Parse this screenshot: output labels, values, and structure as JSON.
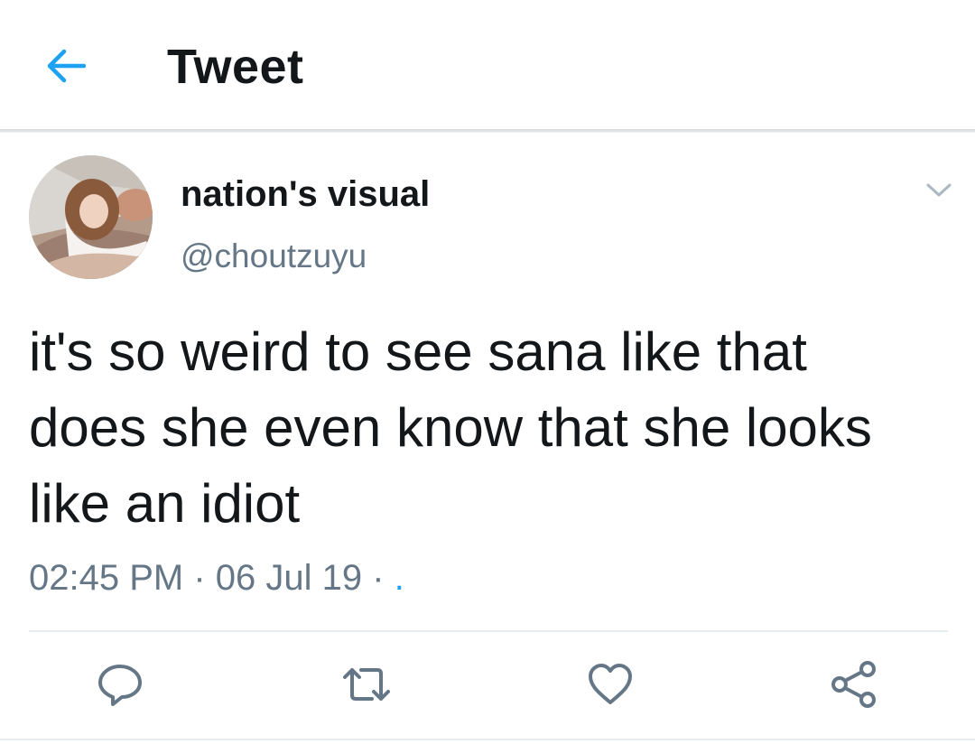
{
  "header": {
    "title": "Tweet",
    "back_icon": "arrow-left-icon",
    "accent_color": "#1da1f2"
  },
  "tweet": {
    "display_name": "nation's visual",
    "handle": "@choutzuyu",
    "text": "it's so weird to see sana like that\ndoes she even know that she looks\nlike an idiot",
    "time": "02:45 PM",
    "date": "06 Jul 19",
    "separator": "·",
    "source": "."
  },
  "actions": [
    {
      "name": "reply",
      "icon": "reply-icon"
    },
    {
      "name": "retweet",
      "icon": "retweet-icon"
    },
    {
      "name": "like",
      "icon": "heart-icon"
    },
    {
      "name": "share",
      "icon": "share-icon"
    }
  ],
  "colors": {
    "text": "#14171a",
    "secondary": "#657786",
    "divider": "#e6ecf0"
  }
}
